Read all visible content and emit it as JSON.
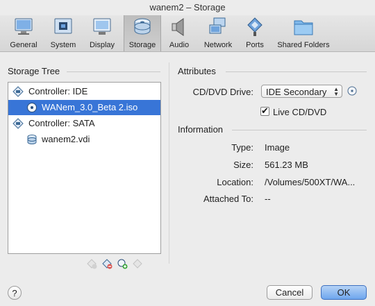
{
  "window": {
    "title": "wanem2 – Storage"
  },
  "toolbar": {
    "items": [
      {
        "label": "General",
        "icon": "monitor-general-icon"
      },
      {
        "label": "System",
        "icon": "chip-icon"
      },
      {
        "label": "Display",
        "icon": "display-icon"
      },
      {
        "label": "Storage",
        "icon": "disk-stack-icon",
        "active": true
      },
      {
        "label": "Audio",
        "icon": "speaker-icon"
      },
      {
        "label": "Network",
        "icon": "network-icon"
      },
      {
        "label": "Ports",
        "icon": "ports-icon"
      },
      {
        "label": "Shared Folders",
        "icon": "folder-icon"
      }
    ]
  },
  "storage_tree": {
    "title": "Storage Tree",
    "items": [
      {
        "label": "Controller: IDE",
        "icon": "ide-controller-icon",
        "level": 0
      },
      {
        "label": "WANem_3.0_Beta 2.iso",
        "icon": "optical-disc-icon",
        "level": 1,
        "selected": true
      },
      {
        "label": "Controller: SATA",
        "icon": "sata-controller-icon",
        "level": 0
      },
      {
        "label": "wanem2.vdi",
        "icon": "hard-disk-icon",
        "level": 1
      }
    ],
    "buttons": [
      {
        "icon": "add-controller-icon",
        "enabled": false
      },
      {
        "icon": "remove-controller-icon",
        "enabled": true
      },
      {
        "icon": "add-attachment-icon",
        "enabled": true
      },
      {
        "icon": "remove-attachment-icon",
        "enabled": false
      }
    ]
  },
  "attributes": {
    "title": "Attributes",
    "cd_dvd_drive_label": "CD/DVD Drive:",
    "cd_dvd_drive_value": "IDE Secondary",
    "live_cd_label": "Live CD/DVD",
    "live_cd_checked": true
  },
  "information": {
    "title": "Information",
    "type_label": "Type:",
    "type_value": "Image",
    "size_label": "Size:",
    "size_value": "561.23 MB",
    "location_label": "Location:",
    "location_value": "/Volumes/500XT/WA...",
    "attached_label": "Attached To:",
    "attached_value": "--"
  },
  "footer": {
    "help_label": "?",
    "cancel_label": "Cancel",
    "ok_label": "OK"
  },
  "colors": {
    "selection": "#3875d7",
    "ok_button": "#6ea6ee"
  }
}
